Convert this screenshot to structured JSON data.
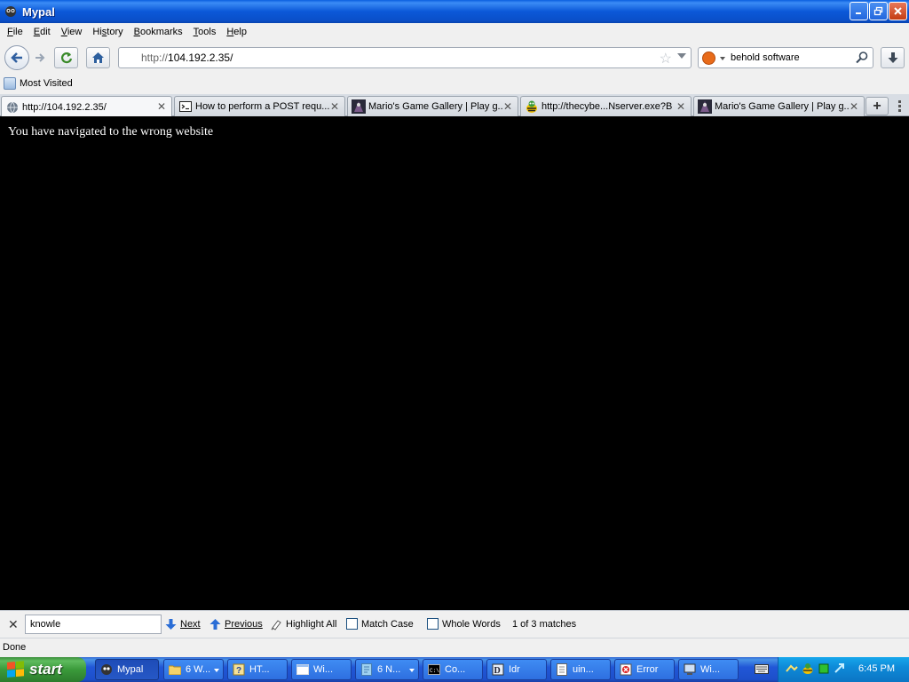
{
  "window": {
    "title": "Mypal",
    "buttons": [
      "minimize",
      "restore",
      "close"
    ]
  },
  "menu": {
    "items": [
      {
        "label": "File",
        "accel": "F"
      },
      {
        "label": "Edit",
        "accel": "E"
      },
      {
        "label": "View",
        "accel": "V"
      },
      {
        "label": "History",
        "accel": "s"
      },
      {
        "label": "Bookmarks",
        "accel": "B"
      },
      {
        "label": "Tools",
        "accel": "T"
      },
      {
        "label": "Help",
        "accel": "H"
      }
    ]
  },
  "navbar": {
    "url_scheme": "http://",
    "url_host": "104.192.2.35/",
    "search_query": "behold software",
    "icons": [
      "back-icon",
      "forward-icon",
      "reload-icon",
      "home-icon",
      "star-icon",
      "search-engine-icon",
      "magnifier-icon",
      "download-icon"
    ]
  },
  "bookmarks": {
    "items": [
      {
        "label": "Most Visited",
        "icon": "bookmark-folder-icon"
      }
    ]
  },
  "tabs": [
    {
      "label": "http://104.192.2.35/",
      "icon": "globe-icon",
      "active": true
    },
    {
      "label": "How to perform a POST requ...",
      "icon": "terminal-icon",
      "active": false
    },
    {
      "label": "Mario's Game Gallery | Play g...",
      "icon": "game-thumbnail-icon",
      "active": false
    },
    {
      "label": "http://thecybe...Nserver.exe?B",
      "icon": "bee-icon",
      "active": false
    },
    {
      "label": "Mario's Game Gallery | Play g...",
      "icon": "game-thumbnail-icon",
      "active": false
    }
  ],
  "content": {
    "message": "You have navigated to the wrong website",
    "background": "#000000",
    "text_color": "#ffffff"
  },
  "findbar": {
    "query": "knowle",
    "next_label": "Next",
    "previous_label": "Previous",
    "highlight_label": "Highlight All",
    "match_case_label": "Match Case",
    "match_case_checked": false,
    "whole_words_label": "Whole Words",
    "whole_words_checked": false,
    "result": "1 of 3 matches"
  },
  "statusbar": {
    "text": "Done"
  },
  "taskbar": {
    "start_label": "start",
    "tasks": [
      {
        "label": "Mypal",
        "icon": "mypal-icon",
        "active": true
      },
      {
        "label": "6 W...",
        "icon": "folder-icon",
        "active": false,
        "group": true
      },
      {
        "label": "HT...",
        "icon": "help-icon",
        "active": false
      },
      {
        "label": "Wi...",
        "icon": "window-icon",
        "active": false
      },
      {
        "label": "6 N...",
        "icon": "notepad-icon",
        "active": false,
        "group": true
      },
      {
        "label": "Co...",
        "icon": "cmd-icon",
        "active": false
      },
      {
        "label": "Idr",
        "icon": "idr-icon",
        "active": false
      },
      {
        "label": "uin...",
        "icon": "document-icon",
        "active": false
      },
      {
        "label": "Error",
        "icon": "error-icon",
        "active": false
      },
      {
        "label": "Wi...",
        "icon": "computer-icon",
        "active": false
      }
    ],
    "tray_icons": [
      "keyboard-icon",
      "network-icon",
      "bee-tray-icon",
      "green-square-icon",
      "arrow-tray-icon"
    ],
    "clock": "6:45 PM"
  },
  "colors": {
    "titlebar": "#0b58d8",
    "taskbar": "#2157d7",
    "start_button": "#3a9a3a",
    "tray": "#0e8ad8"
  }
}
